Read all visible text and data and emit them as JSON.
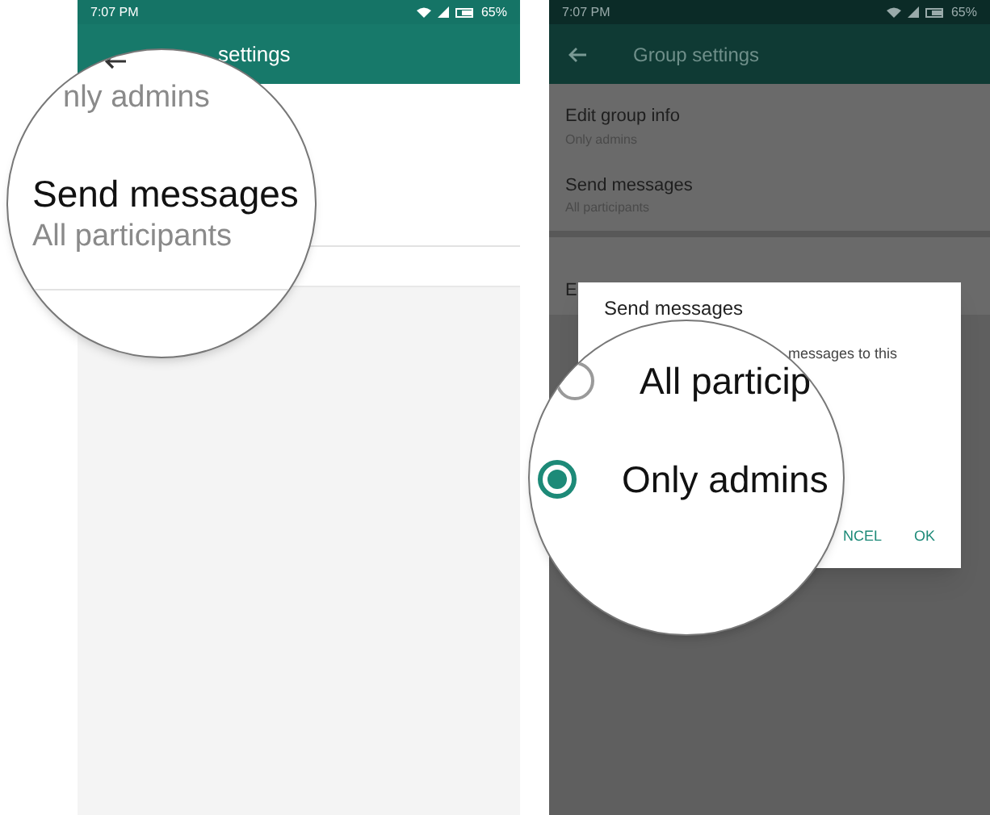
{
  "left_screen": {
    "status_bar": {
      "time": "7:07 PM",
      "battery": "65%"
    },
    "toolbar": {
      "title": "settings"
    },
    "magnifier": {
      "items": [
        {
          "subtitle": "nly admins"
        },
        {
          "title": "Send messages",
          "subtitle": "All participants"
        }
      ]
    }
  },
  "right_screen": {
    "status_bar": {
      "time": "7:07 PM",
      "battery": "65%"
    },
    "toolbar": {
      "title": "Group settings"
    },
    "settings": [
      {
        "title": "Edit group info",
        "subtitle": "Only admins"
      },
      {
        "title": "Send messages",
        "subtitle": "All participants"
      },
      {
        "title": "E"
      }
    ],
    "dialog": {
      "title": "Send messages",
      "text": "messages to this",
      "buttons": [
        "NCEL",
        "OK"
      ]
    },
    "magnifier": {
      "options": [
        {
          "label": "All particip",
          "selected": false
        },
        {
          "label": "Only admins",
          "selected": true
        }
      ]
    }
  }
}
